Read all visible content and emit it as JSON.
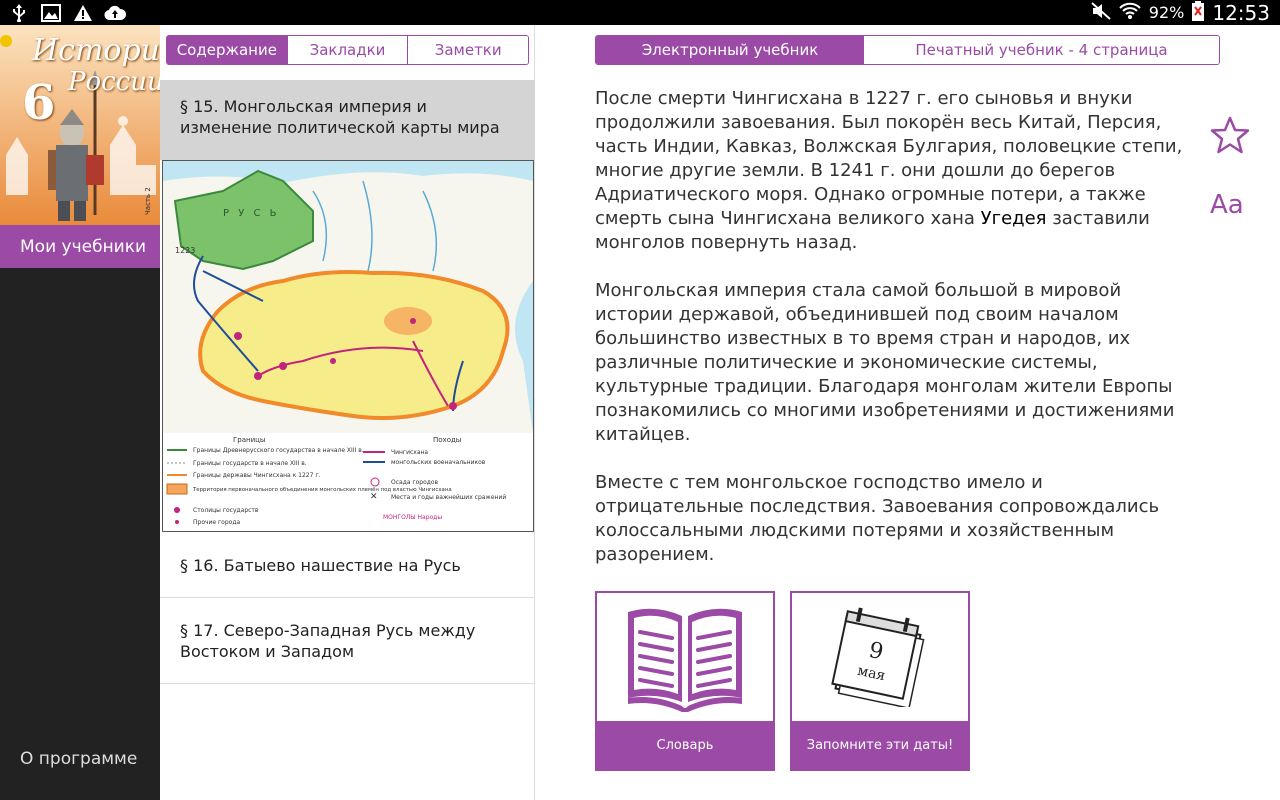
{
  "statusbar": {
    "battery": "92%",
    "time": "12:53"
  },
  "sidebar": {
    "cover_title_line1": "История",
    "cover_title_line2": "России",
    "cover_grade": "6",
    "my_books": "Мои учебники",
    "about": "О программе"
  },
  "middle": {
    "tabs": [
      "Содержание",
      "Закладки",
      "Заметки"
    ],
    "active_item": "§ 15. Монгольская империя и изменение политической карты мира",
    "items": [
      "§ 16. Батыево нашествие на Русь",
      "§ 17. Северо-Западная Русь между Востоком и Западом"
    ],
    "map": {
      "label_rus": "Р У С Ь",
      "label_year": "1223",
      "legend_borders": "Границы",
      "legend_campaigns": "Походы",
      "legend_1": "Границы Древнерусского государства в начале XIII в.",
      "legend_2": "Границы государств в начале XIII в.",
      "legend_3": "Границы державы Чингисхана к 1227 г.",
      "legend_4": "Территория первоначального объединения монгольских племён под властью Чингисхана",
      "legend_5": "Столицы государств",
      "legend_6": "Прочие города",
      "legend_7": "Чингисхана",
      "legend_8": "монгольских военачальников",
      "legend_9": "Осада городов",
      "legend_10": "Места и годы важнейших сражений",
      "legend_11": "МОНГОЛЫ Народы"
    }
  },
  "content": {
    "tabs": [
      "Электронный учебник",
      "Печатный учебник - 4 страница"
    ],
    "p1_a": "После смерти Чингисхана в 1227 г. его сыновья и внуки продолжили завоевания. Был покорён весь Китай, Персия, часть Индии, Кавказ, Волжская Булгария, половецкие степи, многие другие земли. В 1241 г. они дошли до берегов Адриатического моря. Однако огромные потери, а также смерть сына Чингисхана великого хана ",
    "p1_b": "Угедея",
    "p1_c": " заставили монголов повернуть назад.",
    "p2": "Монгольская империя стала самой большой в мировой истории державой, объединившей под своим началом большинство известных в то время стран и народов, их различные политические и экономические системы, культурные традиции. Благодаря монголам жители Европы познакомились со многими изобретениями и достижениями китайцев.",
    "p3": "Вместе с тем монгольское господство имело и отрицательные последствия. Завоевания сопровождались колоссальными людскими потерями и хозяйственным разорением.",
    "font_button": "Aa",
    "card1": "Словарь",
    "card2": "Запомните эти даты!",
    "calendar_day": "9",
    "calendar_month": "мая"
  },
  "colors": {
    "accent": "#9b4aa6",
    "sidebar_bg": "#222222"
  }
}
